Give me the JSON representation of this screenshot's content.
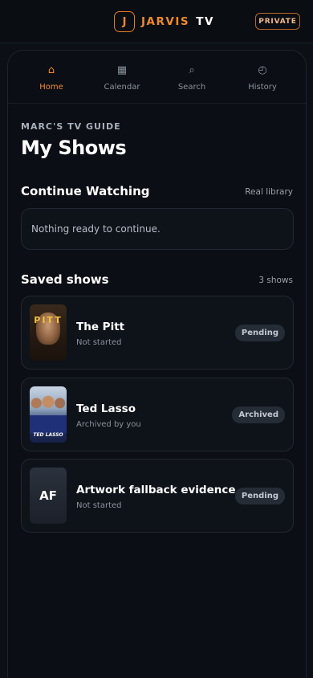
{
  "header": {
    "logo_letter": "J",
    "brand_accent": "JARVIS",
    "brand_plain": "TV",
    "private_label": "PRIVATE"
  },
  "tabs": [
    {
      "label": "Home",
      "icon": "home-icon",
      "glyph": "⌂",
      "active": true
    },
    {
      "label": "Calendar",
      "icon": "calendar-icon",
      "glyph": "▦",
      "active": false
    },
    {
      "label": "Search",
      "icon": "search-icon",
      "glyph": "⌕",
      "active": false
    },
    {
      "label": "History",
      "icon": "history-icon",
      "glyph": "◴",
      "active": false
    }
  ],
  "page": {
    "kicker": "MARC'S TV GUIDE",
    "title": "My Shows"
  },
  "continue_watching": {
    "title": "Continue Watching",
    "meta": "Real library",
    "empty_text": "Nothing ready to continue."
  },
  "saved_shows": {
    "title": "Saved shows",
    "meta": "3 shows",
    "items": [
      {
        "title": "The Pitt",
        "subtitle": "Not started",
        "status": "Pending",
        "poster_text": "PITT"
      },
      {
        "title": "Ted Lasso",
        "subtitle": "Archived by you",
        "status": "Archived",
        "poster_text": "TED LASSO"
      },
      {
        "title": "Artwork fallback evidence",
        "subtitle": "Not started",
        "status": "Pending",
        "poster_text": "AF"
      }
    ]
  },
  "colors": {
    "accent": "#ef8a2e",
    "background": "#0c0f15"
  }
}
